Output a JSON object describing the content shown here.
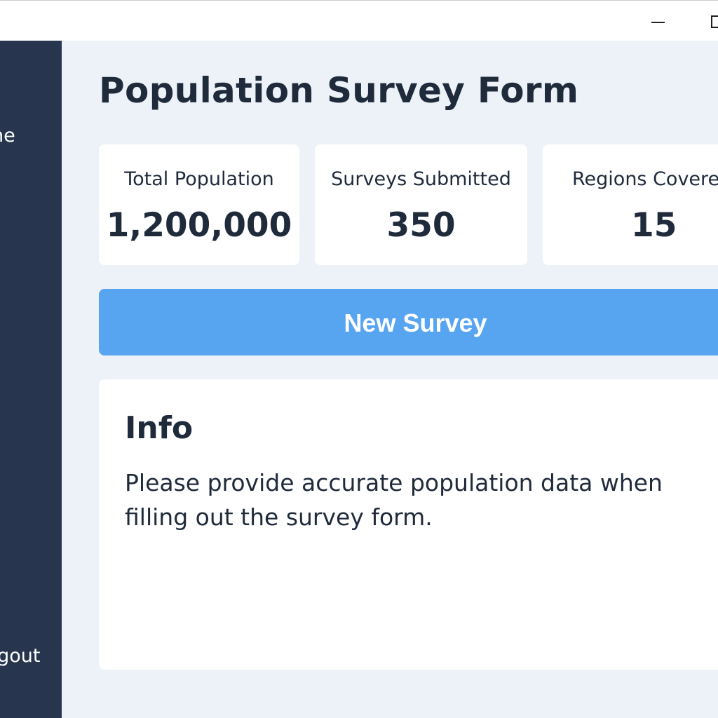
{
  "window": {
    "controls": {
      "minimize_icon": "minimize-icon",
      "maximize_icon": "maximize-icon"
    }
  },
  "sidebar": {
    "items": [
      {
        "label": "Home"
      },
      {
        "label": "Logout"
      }
    ]
  },
  "main": {
    "title": "Population Survey Form",
    "stats": [
      {
        "label": "Total Population",
        "value": "1,200,000"
      },
      {
        "label": "Surveys Submitted",
        "value": "350"
      },
      {
        "label": "Regions Covered",
        "value": "15"
      }
    ],
    "new_survey_label": "New Survey",
    "info": {
      "title": "Info",
      "text": "Please provide accurate population data when filling out the survey form."
    }
  },
  "colors": {
    "sidebar_bg": "#27364e",
    "main_bg": "#edf2f9",
    "accent": "#57a5f1",
    "text": "#1f2a3b"
  }
}
